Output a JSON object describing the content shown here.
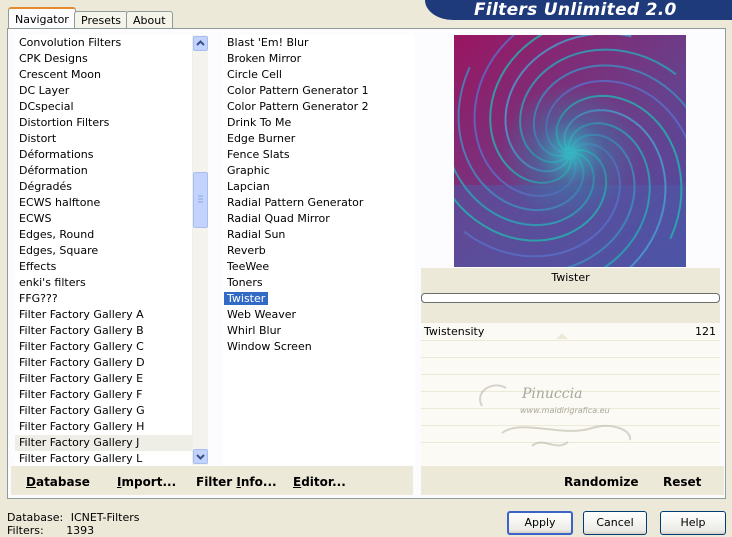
{
  "window": {
    "title": "Filters Unlimited 2.0"
  },
  "tabs": [
    {
      "label": "Navigator",
      "active": true
    },
    {
      "label": "Presets",
      "active": false
    },
    {
      "label": "About",
      "active": false
    }
  ],
  "categories": {
    "items": [
      "Convolution Filters",
      "CPK Designs",
      "Crescent Moon",
      "DC Layer",
      "DCspecial",
      "Distortion Filters",
      "Distort",
      "Déformations",
      "Déformation",
      "Dégradés",
      "ECWS halftone",
      "ECWS",
      "Edges, Round",
      "Edges, Square",
      "Effects",
      "enki's filters",
      "FFG???",
      "Filter Factory Gallery A",
      "Filter Factory Gallery B",
      "Filter Factory Gallery C",
      "Filter Factory Gallery D",
      "Filter Factory Gallery E",
      "Filter Factory Gallery F",
      "Filter Factory Gallery G",
      "Filter Factory Gallery H",
      "Filter Factory Gallery J",
      "Filter Factory Gallery L"
    ],
    "selected": "Filter Factory Gallery J"
  },
  "filters": {
    "items": [
      "Blast 'Em! Blur",
      "Broken Mirror",
      "Circle Cell",
      "Color Pattern Generator 1",
      "Color Pattern Generator 2",
      "Drink To Me",
      "Edge Burner",
      "Fence Slats",
      "Graphic",
      "Lapcian",
      "Radial Pattern Generator",
      "Radial Quad Mirror",
      "Radial Sun",
      "Reverb",
      "TeeWee",
      "Toners",
      "Twister",
      "Web Weaver",
      "Whirl Blur",
      "Window Screen"
    ],
    "selected": "Twister"
  },
  "preview": {
    "filter_name": "Twister",
    "progress": 0
  },
  "parameters": [
    {
      "label": "Twistensity",
      "value": "121"
    }
  ],
  "watermark": {
    "text1": "Pinuccia",
    "text2": "www.maidirigrafica.eu"
  },
  "left_buttons": {
    "database": {
      "hot": "D",
      "rest": "atabase"
    },
    "import": {
      "hot": "I",
      "rest": "mport..."
    },
    "filter_info": {
      "pre": "Filter ",
      "hot": "I",
      "rest": "nfo..."
    },
    "editor": {
      "hot": "E",
      "rest": "ditor..."
    }
  },
  "right_buttons": {
    "randomize": "Randomize",
    "reset": "Reset"
  },
  "dialog_buttons": {
    "apply": "Apply",
    "cancel": "Cancel",
    "help": "Help"
  },
  "status": {
    "database_label": "Database:",
    "database_value": "ICNET-Filters",
    "filters_label": "Filters:",
    "filters_value": "1393"
  }
}
